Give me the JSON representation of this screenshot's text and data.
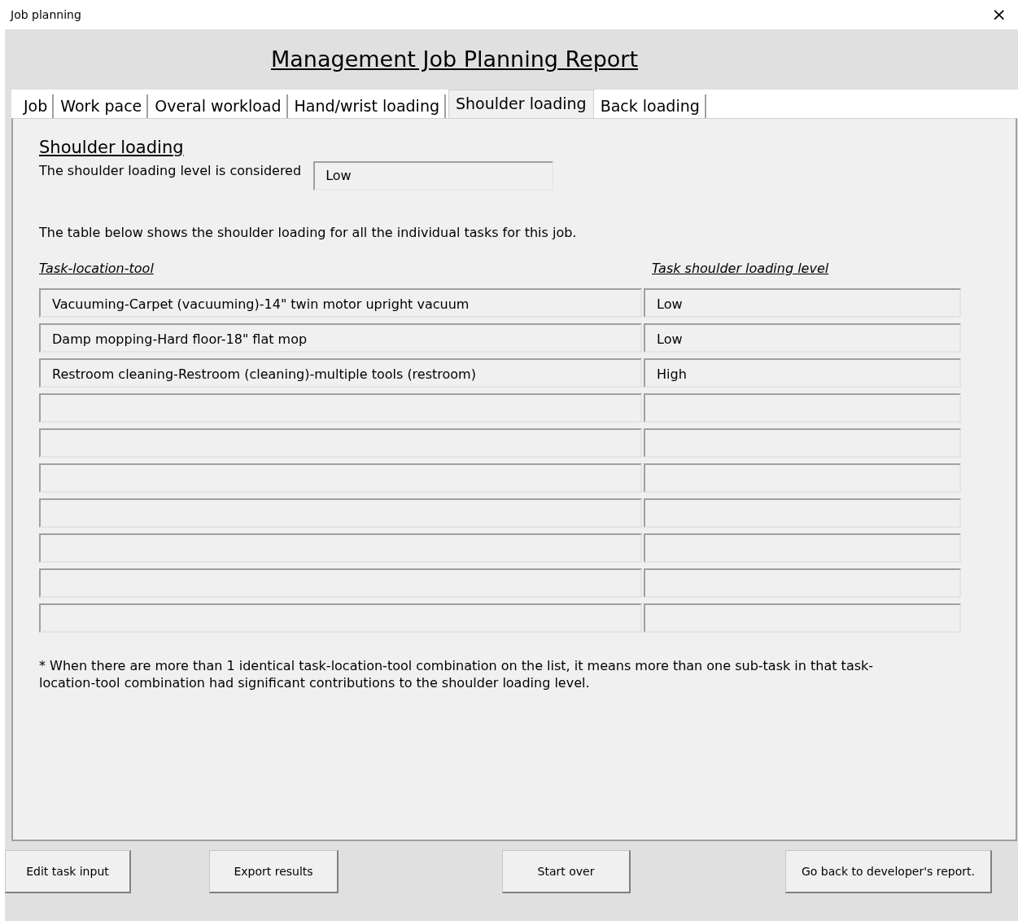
{
  "window": {
    "title": "Job planning",
    "close": "×"
  },
  "report_title": "Management Job Planning Report",
  "tabs": [
    {
      "label": "Job",
      "selected": false
    },
    {
      "label": "Work pace",
      "selected": false
    },
    {
      "label": "Overal workload",
      "selected": false
    },
    {
      "label": "Hand/wrist loading",
      "selected": false
    },
    {
      "label": "Shoulder loading",
      "selected": true
    },
    {
      "label": "Back loading",
      "selected": false
    }
  ],
  "section": {
    "heading": "Shoulder loading",
    "level_label": "The shoulder loading level is considered",
    "level_value": "Low",
    "intro": "The table below shows the shoulder loading for all the individual tasks for this job."
  },
  "table": {
    "columns": [
      "Task-location-tool",
      "Task shoulder loading level"
    ],
    "rows": [
      {
        "task": "Vacuuming-Carpet (vacuuming)-14\" twin motor upright vacuum",
        "level": "Low"
      },
      {
        "task": "Damp mopping-Hard floor-18\" flat mop",
        "level": "Low"
      },
      {
        "task": "Restroom cleaning-Restroom (cleaning)-multiple tools (restroom)",
        "level": "High"
      },
      {},
      {},
      {},
      {},
      {},
      {},
      {}
    ]
  },
  "footnote": "* When there are more than 1 identical task-location-tool combination on the list, it means more than one sub-task in that task-location-tool combination had significant contributions to the shoulder loading level.",
  "buttons": [
    {
      "label": "Edit task input",
      "kind": "left"
    },
    {
      "label": "Export results",
      "kind": "left"
    },
    {
      "label": "Start over",
      "kind": "center"
    },
    {
      "label": "Go back to developer's report.",
      "kind": "right"
    }
  ]
}
